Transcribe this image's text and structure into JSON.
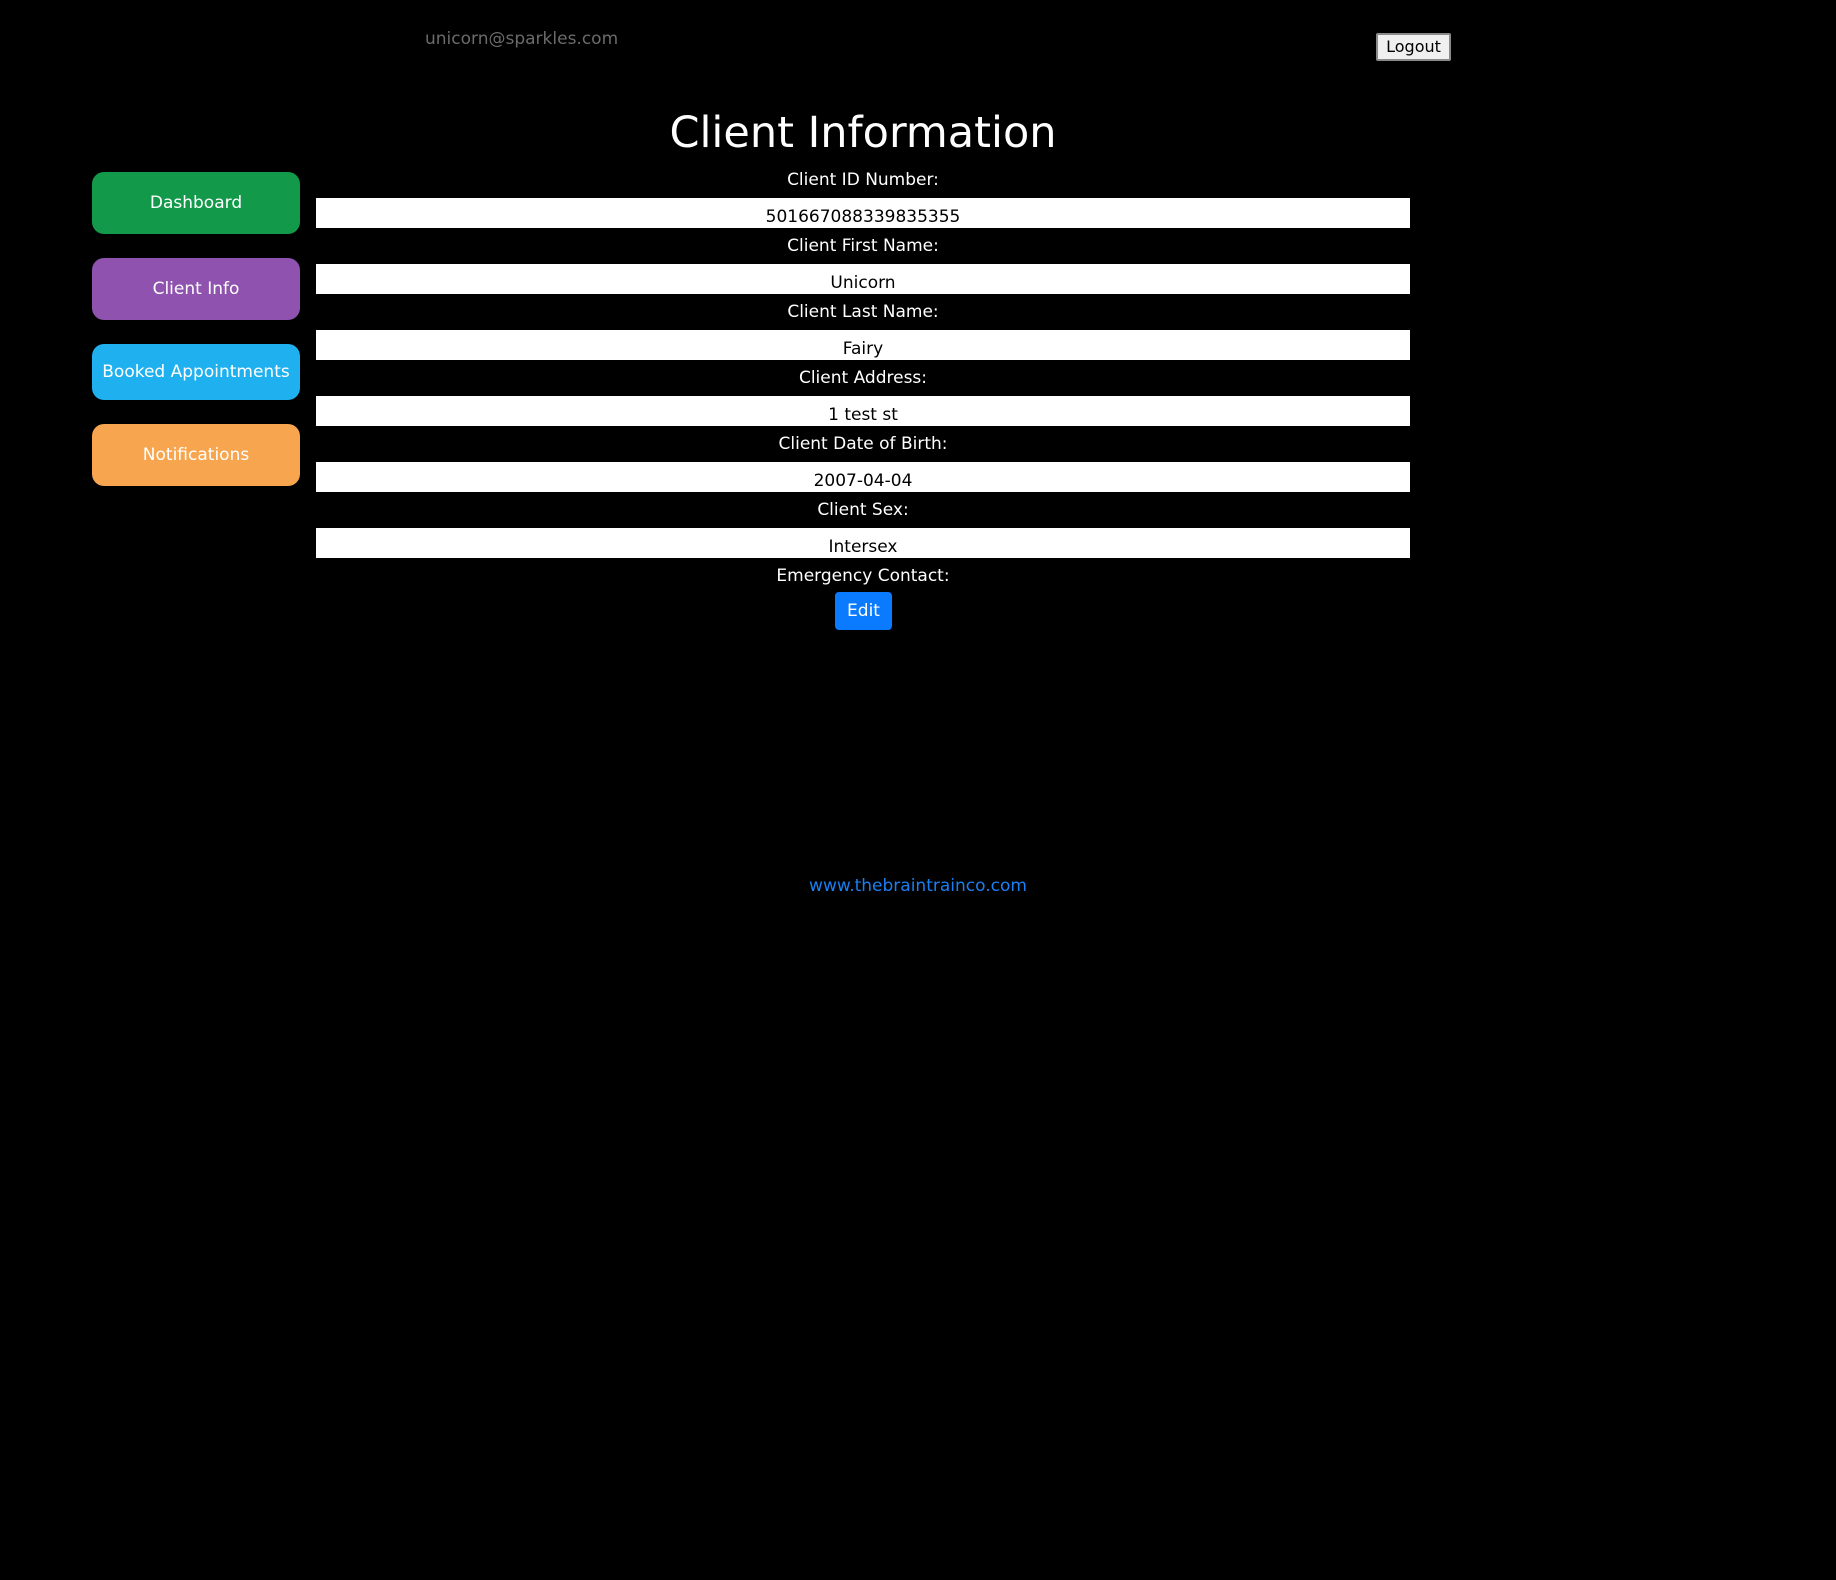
{
  "header": {
    "user_email": "unicorn@sparkles.com",
    "logout_label": "Logout"
  },
  "page": {
    "title": "Client Information"
  },
  "sidebar": {
    "items": [
      {
        "label": "Dashboard",
        "color": "#129a4a"
      },
      {
        "label": "Client Info",
        "color": "#8f52af"
      },
      {
        "label": "Booked Appointments",
        "color": "#1fb0ef"
      },
      {
        "label": "Notifications",
        "color": "#f7a54f"
      }
    ]
  },
  "fields": [
    {
      "label": "Client ID Number:",
      "value": "501667088339835355"
    },
    {
      "label": "Client First Name:",
      "value": "Unicorn"
    },
    {
      "label": "Client Last Name:",
      "value": "Fairy"
    },
    {
      "label": "Client Address:",
      "value": "1 test st"
    },
    {
      "label": "Client Date of Birth:",
      "value": "2007-04-04"
    },
    {
      "label": "Client Sex:",
      "value": "Intersex"
    }
  ],
  "emergency_contact": {
    "label": "Emergency Contact:",
    "edit_label": "Edit"
  },
  "footer": {
    "link_text": "www.thebraintrainco.com"
  },
  "colors": {
    "background": "#000000",
    "edit_button": "#0a7bff",
    "footer_link": "#1a7ff0"
  }
}
